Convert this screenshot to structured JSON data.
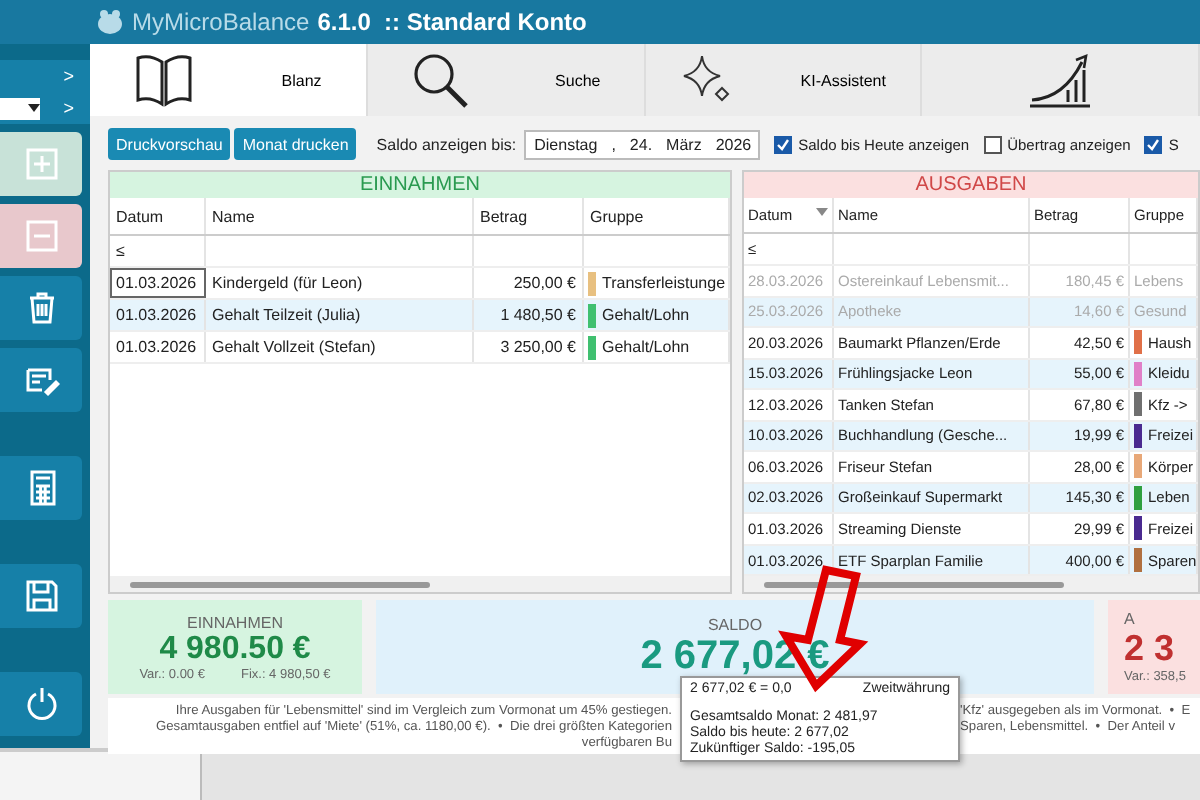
{
  "window": {
    "app_name": "MyMicroBalance",
    "title": "6.1.0  :: Standard Konto"
  },
  "sidebar": {
    "arrows": [
      ">",
      ">"
    ]
  },
  "tabs": [
    {
      "label": "Blanz",
      "selected": true
    },
    {
      "label": "Suche",
      "selected": false
    },
    {
      "label": "KI-Assistent",
      "selected": false
    },
    {
      "selected": false
    }
  ],
  "toolbar": {
    "buttons": [
      "Druckvorschau",
      "Monat drucken"
    ],
    "saldo_label": "Saldo anzeigen bis:",
    "date_parts": [
      "Dienstag",
      ",",
      "24.",
      "März",
      "2026"
    ],
    "checkboxes": [
      {
        "label": "Saldo bis Heute anzeigen",
        "checked": true
      },
      {
        "label": "Übertrag anzeigen",
        "checked": false
      },
      {
        "label": "S",
        "checked": true
      }
    ]
  },
  "income": {
    "title": "EINNAHMEN",
    "columns": [
      "Datum",
      "Name",
      "Betrag",
      "Gruppe"
    ],
    "filter": "≤",
    "rows": [
      {
        "date": "01.03.2026",
        "name": "Kindergeld (für Leon)",
        "amount": "250,00 €",
        "group": "Transferleistunge",
        "color": "#e8c080",
        "future": false
      },
      {
        "date": "01.03.2026",
        "name": "Gehalt Teilzeit (Julia)",
        "amount": "1 480,50 €",
        "group": "Gehalt/Lohn",
        "color": "#40c070",
        "future": false
      },
      {
        "date": "01.03.2026",
        "name": "Gehalt Vollzeit (Stefan)",
        "amount": "3 250,00 €",
        "group": "Gehalt/Lohn",
        "color": "#40c070",
        "future": false
      }
    ]
  },
  "expenses": {
    "title": "AUSGABEN",
    "columns": [
      "Datum",
      "Name",
      "Betrag",
      "Gruppe"
    ],
    "filter": "≤",
    "rows": [
      {
        "date": "28.03.2026",
        "name": "Ostereinkauf Lebensmit...",
        "amount": "180,45 €",
        "group": "Lebens",
        "future": true
      },
      {
        "date": "25.03.2026",
        "name": "Apotheke",
        "amount": "14,60 €",
        "group": "Gesund",
        "future": true
      },
      {
        "date": "20.03.2026",
        "name": "Baumarkt Pflanzen/Erde",
        "amount": "42,50 €",
        "group": "Haush",
        "color": "#e07048",
        "future": false
      },
      {
        "date": "15.03.2026",
        "name": "Frühlingsjacke Leon",
        "amount": "55,00 €",
        "group": "Kleidu",
        "color": "#e080c8",
        "future": false
      },
      {
        "date": "12.03.2026",
        "name": "Tanken Stefan",
        "amount": "67,80 €",
        "group": "Kfz -> ",
        "color": "#707070",
        "future": false
      },
      {
        "date": "10.03.2026",
        "name": "Buchhandlung (Gesche...",
        "amount": "19,99 €",
        "group": "Freizei",
        "color": "#4a2a90",
        "future": false
      },
      {
        "date": "06.03.2026",
        "name": "Friseur Stefan",
        "amount": "28,00 €",
        "group": "Körper",
        "color": "#e8a878",
        "future": false
      },
      {
        "date": "02.03.2026",
        "name": "Großeinkauf Supermarkt",
        "amount": "145,30 €",
        "group": "Leben",
        "color": "#30a040",
        "future": false
      },
      {
        "date": "01.03.2026",
        "name": "Streaming Dienste",
        "amount": "29,99 €",
        "group": "Freizei",
        "color": "#4a2a90",
        "future": false
      },
      {
        "date": "01.03.2026",
        "name": "ETF Sparplan Familie",
        "amount": "400,00 €",
        "group": "Sparen",
        "color": "#b07040",
        "future": false
      }
    ]
  },
  "summary": {
    "income": {
      "label": "EINNAHMEN",
      "value": "4 980.50 €",
      "var": "Var.: 0.00 €",
      "fix": "Fix.: 4 980,50 €"
    },
    "saldo": {
      "label": "SALDO",
      "value": "2 677,02 €"
    },
    "expenses": {
      "label": "A",
      "value": "2 3",
      "var": "Var.: 358,5"
    }
  },
  "info_lines": [
    {
      "left": "Ihre Ausgaben für 'Lebensmittel' sind im Vergleich zum Vormonat um 45% gestiegen.",
      "right": "'Kfz' ausgegeben als im Vormonat.  •  E"
    },
    {
      "left": "Gesamtausgaben entfiel auf 'Miete' (51%, ca. 1180,00 €).  •  Die drei größten Kategorien",
      "right": "Sparen, Lebensmittel.  •  Der Anteil v"
    },
    {
      "left": "verfügbaren Bu"
    }
  ],
  "tooltip": {
    "first_left": "2 677,02 € = 0,0",
    "first_right": "Zweitwährung",
    "lines": [
      "Gesamtsaldo Monat: 2 481,97",
      "Saldo bis heute: 2 677,02",
      "Zukünftiger Saldo: -195,05"
    ]
  }
}
